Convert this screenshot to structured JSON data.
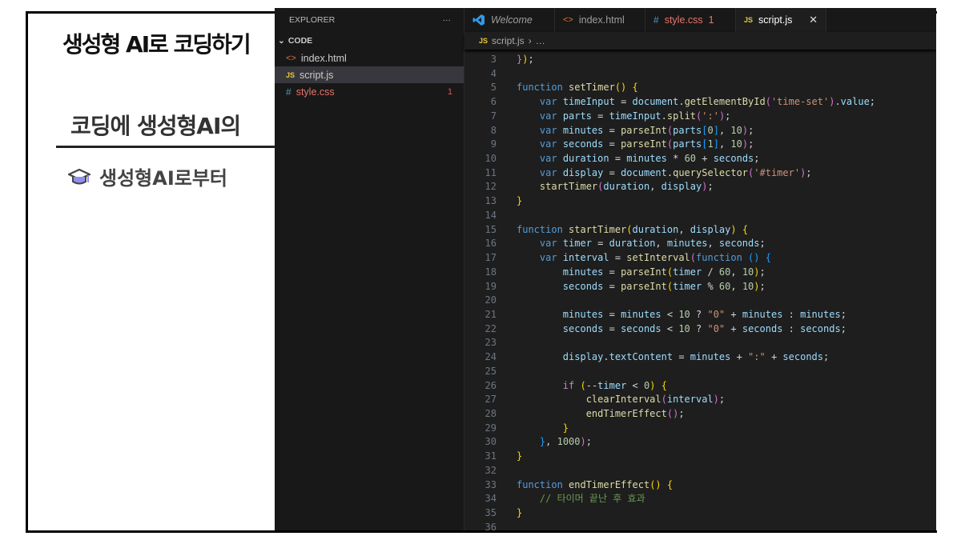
{
  "slide": {
    "title": "생성형 AI로 코딩하기",
    "subtitle": "코딩에 생성형AI의",
    "bullet": "생성형AI로부터",
    "bullet_icon": "graduation-cap-icon"
  },
  "explorer": {
    "header": "EXPLORER",
    "more": "···",
    "folder": "CODE",
    "files": [
      {
        "name": "index.html",
        "icon": "html-icon"
      },
      {
        "name": "script.js",
        "icon": "js-icon",
        "selected": true
      },
      {
        "name": "style.css",
        "icon": "css-icon",
        "problems": "1"
      }
    ]
  },
  "tabs": [
    {
      "label": "Welcome",
      "icon": "vscode-icon"
    },
    {
      "label": "index.html",
      "icon": "html-icon"
    },
    {
      "label": "style.css",
      "icon": "css-icon",
      "problems": "1"
    },
    {
      "label": "script.js",
      "icon": "js-icon",
      "active": true,
      "close": "✕"
    }
  ],
  "breadcrumb": {
    "file": "script.js",
    "rest": "…"
  },
  "colors": {
    "keyword": "#569cd6",
    "function": "#dcdcaa",
    "variable": "#9cdcfe",
    "string": "#ce9178",
    "number": "#b5cea8",
    "comment": "#6a9955",
    "editor_bg": "#1e1e1e"
  },
  "code": [
    {
      "n": "3",
      "t": [
        [
          "}",
          "b2"
        ],
        [
          ")",
          "b1"
        ],
        [
          ";",
          "p"
        ]
      ]
    },
    {
      "n": "4",
      "t": []
    },
    {
      "n": "5",
      "t": [
        [
          "function ",
          "k"
        ],
        [
          "setTimer",
          "f"
        ],
        [
          "()",
          "b1"
        ],
        [
          " ",
          "p"
        ],
        [
          "{",
          "b1"
        ]
      ]
    },
    {
      "n": "6",
      "t": [
        [
          "    ",
          "p"
        ],
        [
          "var ",
          "k"
        ],
        [
          "timeInput",
          "v"
        ],
        [
          " = ",
          "p"
        ],
        [
          "document",
          "v"
        ],
        [
          ".",
          "p"
        ],
        [
          "getElementById",
          "f"
        ],
        [
          "(",
          "b2"
        ],
        [
          "'time-set'",
          "s"
        ],
        [
          ")",
          "b2"
        ],
        [
          ".",
          "p"
        ],
        [
          "value",
          "v"
        ],
        [
          ";",
          "p"
        ]
      ]
    },
    {
      "n": "7",
      "t": [
        [
          "    ",
          "p"
        ],
        [
          "var ",
          "k"
        ],
        [
          "parts",
          "v"
        ],
        [
          " = ",
          "p"
        ],
        [
          "timeInput",
          "v"
        ],
        [
          ".",
          "p"
        ],
        [
          "split",
          "f"
        ],
        [
          "(",
          "b2"
        ],
        [
          "':'",
          "s"
        ],
        [
          ")",
          "b2"
        ],
        [
          ";",
          "p"
        ]
      ]
    },
    {
      "n": "8",
      "t": [
        [
          "    ",
          "p"
        ],
        [
          "var ",
          "k"
        ],
        [
          "minutes",
          "v"
        ],
        [
          " = ",
          "p"
        ],
        [
          "parseInt",
          "f"
        ],
        [
          "(",
          "b2"
        ],
        [
          "parts",
          "v"
        ],
        [
          "[",
          "b3"
        ],
        [
          "0",
          "n"
        ],
        [
          "]",
          "b3"
        ],
        [
          ", ",
          "p"
        ],
        [
          "10",
          "n"
        ],
        [
          ")",
          "b2"
        ],
        [
          ";",
          "p"
        ]
      ]
    },
    {
      "n": "9",
      "t": [
        [
          "    ",
          "p"
        ],
        [
          "var ",
          "k"
        ],
        [
          "seconds",
          "v"
        ],
        [
          " = ",
          "p"
        ],
        [
          "parseInt",
          "f"
        ],
        [
          "(",
          "b2"
        ],
        [
          "parts",
          "v"
        ],
        [
          "[",
          "b3"
        ],
        [
          "1",
          "n"
        ],
        [
          "]",
          "b3"
        ],
        [
          ", ",
          "p"
        ],
        [
          "10",
          "n"
        ],
        [
          ")",
          "b2"
        ],
        [
          ";",
          "p"
        ]
      ]
    },
    {
      "n": "10",
      "t": [
        [
          "    ",
          "p"
        ],
        [
          "var ",
          "k"
        ],
        [
          "duration",
          "v"
        ],
        [
          " = ",
          "p"
        ],
        [
          "minutes",
          "v"
        ],
        [
          " * ",
          "p"
        ],
        [
          "60",
          "n"
        ],
        [
          " + ",
          "p"
        ],
        [
          "seconds",
          "v"
        ],
        [
          ";",
          "p"
        ]
      ]
    },
    {
      "n": "11",
      "t": [
        [
          "    ",
          "p"
        ],
        [
          "var ",
          "k"
        ],
        [
          "display",
          "v"
        ],
        [
          " = ",
          "p"
        ],
        [
          "document",
          "v"
        ],
        [
          ".",
          "p"
        ],
        [
          "querySelector",
          "f"
        ],
        [
          "(",
          "b2"
        ],
        [
          "'#timer'",
          "s"
        ],
        [
          ")",
          "b2"
        ],
        [
          ";",
          "p"
        ]
      ]
    },
    {
      "n": "12",
      "t": [
        [
          "    ",
          "p"
        ],
        [
          "startTimer",
          "f"
        ],
        [
          "(",
          "b2"
        ],
        [
          "duration",
          "v"
        ],
        [
          ", ",
          "p"
        ],
        [
          "display",
          "v"
        ],
        [
          ")",
          "b2"
        ],
        [
          ";",
          "p"
        ]
      ]
    },
    {
      "n": "13",
      "t": [
        [
          "}",
          "b1"
        ]
      ]
    },
    {
      "n": "14",
      "t": []
    },
    {
      "n": "15",
      "t": [
        [
          "function ",
          "k"
        ],
        [
          "startTimer",
          "f"
        ],
        [
          "(",
          "b1"
        ],
        [
          "duration",
          "v"
        ],
        [
          ", ",
          "p"
        ],
        [
          "display",
          "v"
        ],
        [
          ")",
          "b1"
        ],
        [
          " ",
          "p"
        ],
        [
          "{",
          "b1"
        ]
      ]
    },
    {
      "n": "16",
      "t": [
        [
          "    ",
          "p"
        ],
        [
          "var ",
          "k"
        ],
        [
          "timer",
          "v"
        ],
        [
          " = ",
          "p"
        ],
        [
          "duration",
          "v"
        ],
        [
          ", ",
          "p"
        ],
        [
          "minutes",
          "v"
        ],
        [
          ", ",
          "p"
        ],
        [
          "seconds",
          "v"
        ],
        [
          ";",
          "p"
        ]
      ]
    },
    {
      "n": "17",
      "t": [
        [
          "    ",
          "p"
        ],
        [
          "var ",
          "k"
        ],
        [
          "interval",
          "v"
        ],
        [
          " = ",
          "p"
        ],
        [
          "setInterval",
          "f"
        ],
        [
          "(",
          "b2"
        ],
        [
          "function ",
          "k"
        ],
        [
          "()",
          "b3"
        ],
        [
          " ",
          "p"
        ],
        [
          "{",
          "b3"
        ]
      ]
    },
    {
      "n": "18",
      "t": [
        [
          "        ",
          "p"
        ],
        [
          "minutes",
          "v"
        ],
        [
          " = ",
          "p"
        ],
        [
          "parseInt",
          "f"
        ],
        [
          "(",
          "b1"
        ],
        [
          "timer",
          "v"
        ],
        [
          " / ",
          "p"
        ],
        [
          "60",
          "n"
        ],
        [
          ", ",
          "p"
        ],
        [
          "10",
          "n"
        ],
        [
          ")",
          "b1"
        ],
        [
          ";",
          "p"
        ]
      ]
    },
    {
      "n": "19",
      "t": [
        [
          "        ",
          "p"
        ],
        [
          "seconds",
          "v"
        ],
        [
          " = ",
          "p"
        ],
        [
          "parseInt",
          "f"
        ],
        [
          "(",
          "b1"
        ],
        [
          "timer",
          "v"
        ],
        [
          " % ",
          "p"
        ],
        [
          "60",
          "n"
        ],
        [
          ", ",
          "p"
        ],
        [
          "10",
          "n"
        ],
        [
          ")",
          "b1"
        ],
        [
          ";",
          "p"
        ]
      ]
    },
    {
      "n": "20",
      "t": []
    },
    {
      "n": "21",
      "t": [
        [
          "        ",
          "p"
        ],
        [
          "minutes",
          "v"
        ],
        [
          " = ",
          "p"
        ],
        [
          "minutes",
          "v"
        ],
        [
          " < ",
          "p"
        ],
        [
          "10",
          "n"
        ],
        [
          " ? ",
          "p"
        ],
        [
          "\"0\"",
          "s"
        ],
        [
          " + ",
          "p"
        ],
        [
          "minutes",
          "v"
        ],
        [
          " : ",
          "p"
        ],
        [
          "minutes",
          "v"
        ],
        [
          ";",
          "p"
        ]
      ]
    },
    {
      "n": "22",
      "t": [
        [
          "        ",
          "p"
        ],
        [
          "seconds",
          "v"
        ],
        [
          " = ",
          "p"
        ],
        [
          "seconds",
          "v"
        ],
        [
          " < ",
          "p"
        ],
        [
          "10",
          "n"
        ],
        [
          " ? ",
          "p"
        ],
        [
          "\"0\"",
          "s"
        ],
        [
          " + ",
          "p"
        ],
        [
          "seconds",
          "v"
        ],
        [
          " : ",
          "p"
        ],
        [
          "seconds",
          "v"
        ],
        [
          ";",
          "p"
        ]
      ]
    },
    {
      "n": "23",
      "t": []
    },
    {
      "n": "24",
      "t": [
        [
          "        ",
          "p"
        ],
        [
          "display",
          "v"
        ],
        [
          ".",
          "p"
        ],
        [
          "textContent",
          "v"
        ],
        [
          " = ",
          "p"
        ],
        [
          "minutes",
          "v"
        ],
        [
          " + ",
          "p"
        ],
        [
          "\":\"",
          "s"
        ],
        [
          " + ",
          "p"
        ],
        [
          "seconds",
          "v"
        ],
        [
          ";",
          "p"
        ]
      ]
    },
    {
      "n": "25",
      "t": []
    },
    {
      "n": "26",
      "t": [
        [
          "        ",
          "p"
        ],
        [
          "if",
          "ck"
        ],
        [
          " ",
          "p"
        ],
        [
          "(",
          "b1"
        ],
        [
          "--",
          "p"
        ],
        [
          "timer",
          "v"
        ],
        [
          " < ",
          "p"
        ],
        [
          "0",
          "n"
        ],
        [
          ")",
          "b1"
        ],
        [
          " ",
          "p"
        ],
        [
          "{",
          "b1"
        ]
      ]
    },
    {
      "n": "27",
      "t": [
        [
          "            ",
          "p"
        ],
        [
          "clearInterval",
          "f"
        ],
        [
          "(",
          "b2"
        ],
        [
          "interval",
          "v"
        ],
        [
          ")",
          "b2"
        ],
        [
          ";",
          "p"
        ]
      ]
    },
    {
      "n": "28",
      "t": [
        [
          "            ",
          "p"
        ],
        [
          "endTimerEffect",
          "f"
        ],
        [
          "()",
          "b2"
        ],
        [
          ";",
          "p"
        ]
      ]
    },
    {
      "n": "29",
      "t": [
        [
          "        ",
          "p"
        ],
        [
          "}",
          "b1"
        ]
      ]
    },
    {
      "n": "30",
      "t": [
        [
          "    ",
          "p"
        ],
        [
          "}",
          "b3"
        ],
        [
          ", ",
          "p"
        ],
        [
          "1000",
          "n"
        ],
        [
          ")",
          "b2"
        ],
        [
          ";",
          "p"
        ]
      ]
    },
    {
      "n": "31",
      "t": [
        [
          "}",
          "b1"
        ]
      ]
    },
    {
      "n": "32",
      "t": []
    },
    {
      "n": "33",
      "t": [
        [
          "function ",
          "k"
        ],
        [
          "endTimerEffect",
          "f"
        ],
        [
          "()",
          "b1"
        ],
        [
          " ",
          "p"
        ],
        [
          "{",
          "b1"
        ]
      ]
    },
    {
      "n": "34",
      "t": [
        [
          "    ",
          "p"
        ],
        [
          "// 타이머 끝난 후 효과",
          "c"
        ]
      ]
    },
    {
      "n": "35",
      "t": [
        [
          "}",
          "b1"
        ]
      ]
    },
    {
      "n": "36",
      "t": []
    }
  ]
}
